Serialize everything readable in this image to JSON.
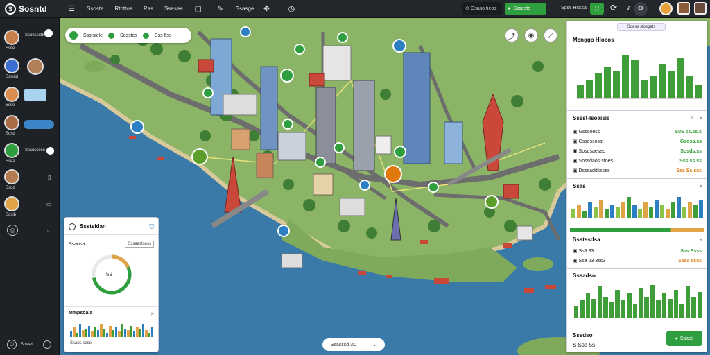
{
  "app": {
    "title": "Sosntd"
  },
  "topbar": {
    "tabs": [
      "Ssoste",
      "Rtottos",
      "Ras",
      "Ssasee",
      "Ssasge"
    ],
    "search_text": "Gsaso tieos",
    "green_button": "Ssseste",
    "right_label": "Sgss Hsssa"
  },
  "sidebar": {
    "items": [
      "Ssite",
      "Sssoid",
      "Ssse",
      "Sosd",
      "Ssea",
      "Ssod",
      "Sosib"
    ],
    "labels": [
      "Ssonssidte",
      "Sssoscese"
    ],
    "bottom_label": "Sossd"
  },
  "map": {
    "legend": [
      "Ssstsiele",
      "Sosstes",
      "Sss 6ss"
    ],
    "bottom_bar": "Ssasssd 3D"
  },
  "left_panel": {
    "title": "Ssstsidan",
    "subtitle": "Ssaosa",
    "dropdown": "Sssaestsoss",
    "donut_value": "59",
    "donut_fraction": 0.72,
    "chart_title": "Mmpsoaia",
    "series_caption": "Ssaos sese"
  },
  "right_panel": {
    "tab": "Sdess stosgets",
    "section1": {
      "title": "Mcnggo Hloeos",
      "bars": [
        0.3,
        0.4,
        0.55,
        0.7,
        0.6,
        0.95,
        0.85,
        0.4,
        0.5,
        0.75,
        0.6,
        0.9,
        0.5,
        0.3
      ]
    },
    "section2": {
      "title": "Sssst-Isoaisie",
      "rows": [
        {
          "label": "Gsssoess",
          "value": "S0S ss.ss.s",
          "tone": "g"
        },
        {
          "label": "Cssessosst",
          "value": "Gsoss.ss",
          "tone": "g"
        },
        {
          "label": "Sosdsaesed",
          "value": "Sosds.ss",
          "tone": "g"
        },
        {
          "label": "Sossdaos sfoes",
          "value": "Sss ss.ss",
          "tone": "g"
        },
        {
          "label": "Dsssaddssses",
          "value": "Sss Ss.sss",
          "tone": "o"
        }
      ]
    },
    "section3": {
      "title": "Ssas",
      "bars": [
        0.4,
        0.6,
        0.3,
        0.7,
        0.5,
        0.8,
        0.4,
        0.6,
        0.5,
        0.7,
        0.9,
        0.6,
        0.4,
        0.7,
        0.5,
        0.8,
        0.6,
        0.4,
        0.7,
        0.9,
        0.5,
        0.7,
        0.6,
        0.8
      ]
    },
    "section4": {
      "title": "Ssstssdsa",
      "rows": [
        {
          "label": "Ss9 33",
          "value": "Sss Ssss",
          "tone": "g"
        },
        {
          "label": "Ssa 23 3ss3",
          "value": "Ssss ssss",
          "tone": "o"
        }
      ]
    },
    "section5": {
      "title": "Sssadso",
      "bars": [
        0.35,
        0.5,
        0.7,
        0.55,
        0.9,
        0.6,
        0.45,
        0.8,
        0.5,
        0.7,
        0.4,
        0.85,
        0.6,
        0.95,
        0.5,
        0.7,
        0.55,
        0.8,
        0.4,
        0.9,
        0.6,
        0.75
      ],
      "footer_title": "Sssdso",
      "footer_value": "S Ssa 5s",
      "button": "Ssaes"
    }
  },
  "colors": {
    "accent": "#2f9e3e",
    "water": "#3a7aa8",
    "land": "#8fb56a",
    "orange": "#e07a10"
  }
}
